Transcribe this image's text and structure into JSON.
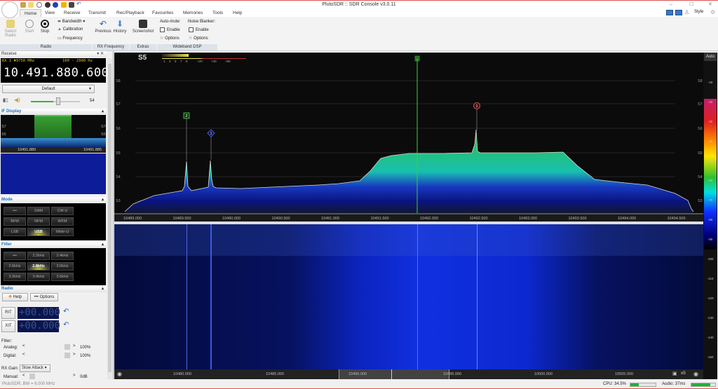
{
  "window": {
    "title": "PlutoSDR :: SDR Console v3.0.11"
  },
  "tabs": [
    "Home",
    "View",
    "Receive",
    "Transmit",
    "Rec/Playback",
    "Favourites",
    "Memories",
    "Tools",
    "Help"
  ],
  "ribbon": {
    "radio": {
      "select": "Select Radio",
      "start": "Start",
      "stop": "Stop",
      "bandwidth": "Bandwidth",
      "calibration": "Calibration",
      "frequency": "Frequency",
      "group": "Radio"
    },
    "rx_frequency": {
      "previous": "Previous",
      "history": "History",
      "group": "RX Frequency"
    },
    "extras": {
      "screenshot": "Screenshot",
      "group": "Extras"
    },
    "wideband_dsp": {
      "auto_mute": "Auto-mute:",
      "noise_blanker": "Noise Blanker:",
      "enable": "Enable",
      "options": "Options",
      "group": "Wideband DSP"
    },
    "style": "Style"
  },
  "receive": {
    "header": "Receive",
    "rx_info": "RX 1 ▼9750 MHz",
    "bandwidth": "100 - 2900 Hz",
    "frequency": "10.491.880.600",
    "preset": "Default",
    "volume": 54,
    "volume_label": "54"
  },
  "if_display": {
    "header": "IF Display",
    "s_labels": [
      "S7",
      "S5",
      "S3"
    ],
    "freq_left": "10491.880",
    "freq_right": "10491.885"
  },
  "mode": {
    "header": "Mode",
    "buttons": [
      "•••",
      "SAM",
      "CW-U",
      "BFM",
      "NFM",
      "WFM",
      "LSB",
      "USB",
      "Wide-U"
    ],
    "selected": "USB"
  },
  "filter": {
    "header": "Filter",
    "buttons": [
      "•••",
      "2.2kHz",
      "2.4kHz",
      "2.6kHz",
      "2.8kHz",
      "3.0kHz",
      "3.2kHz",
      "3.4kHz",
      "3.6kHz"
    ],
    "selected": "2.8kHz"
  },
  "radio_panel": {
    "header": "Radio",
    "help": "Help",
    "options": "••• Options",
    "rit": "RIT",
    "rit_value": "+00.000",
    "xit": "XIT",
    "xit_value": "+00.000",
    "filter_label": "Filter:",
    "analog": "Analog:",
    "analog_value": "100%",
    "digital": "Digital:",
    "digital_value": "100%",
    "rx_gain": "RX Gain:",
    "rx_gain_mode": "Slow Attack",
    "manual": "Manual:",
    "manual_value": "0dB",
    "status": "PlutoSDR, BW = 6.000 MHz"
  },
  "spectrum": {
    "smeter": "S5",
    "smeter_ticks": [
      "1",
      "3",
      "5",
      "7",
      "9",
      "+20",
      "+40",
      "+60"
    ],
    "s_labels": [
      "S8",
      "S7",
      "S6",
      "S5",
      "S4",
      "S3"
    ],
    "freq_ticks": [
      "10489.000",
      "10489.500",
      "10490.000",
      "10490.500",
      "10491.000",
      "10491.500",
      "10492.000",
      "10492.500",
      "10493.000",
      "10493.500",
      "10494.000",
      "10494.500"
    ],
    "markers": [
      {
        "label": "2",
        "color": "#3cb043"
      },
      {
        "label": "1",
        "color": "#4a5adf"
      },
      {
        "label": "1",
        "color": "#d9534f"
      }
    ],
    "vfo_marker": "1"
  },
  "color_scale": {
    "mode": "Auto",
    "ticks": [
      "-10",
      "-20",
      "-30",
      "-40",
      "-50",
      "-60",
      "-70",
      "-80",
      "-90",
      "-100",
      "-110",
      "-120",
      "-130",
      "-140",
      "-150"
    ]
  },
  "overview_axis": {
    "ticks": [
      "10480.000",
      "10485.000",
      "10490.000",
      "10495.000",
      "10500.000",
      "10505.000"
    ],
    "zoom": "x5"
  },
  "status": {
    "cpu": "CPU: 34.5%",
    "cpu_level": 0.345,
    "audio": "Audio: 37ms",
    "audio_level": 0.8
  }
}
